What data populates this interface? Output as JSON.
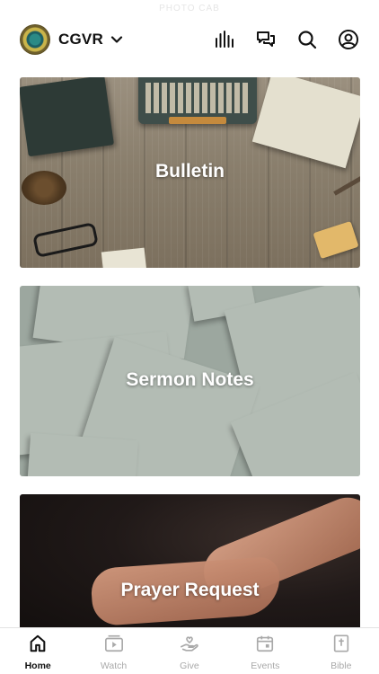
{
  "status": {
    "faint_text": "PHOTO CAB"
  },
  "header": {
    "church_name": "CGVR",
    "icons": [
      "chevron-down-icon",
      "audio-bars-icon",
      "chat-icon",
      "search-icon",
      "profile-icon"
    ]
  },
  "cards": [
    {
      "title": "Bulletin"
    },
    {
      "title": "Sermon Notes"
    },
    {
      "title": "Prayer Request"
    }
  ],
  "tabbar": {
    "active": "Home",
    "tabs": [
      {
        "label": "Home",
        "icon": "home-icon"
      },
      {
        "label": "Watch",
        "icon": "watch-icon"
      },
      {
        "label": "Give",
        "icon": "give-icon"
      },
      {
        "label": "Events",
        "icon": "calendar-icon"
      },
      {
        "label": "Bible",
        "icon": "bible-icon"
      }
    ]
  },
  "colors": {
    "active": "#111111",
    "inactive": "#a9a9a9",
    "divider": "#e3e3e3"
  }
}
